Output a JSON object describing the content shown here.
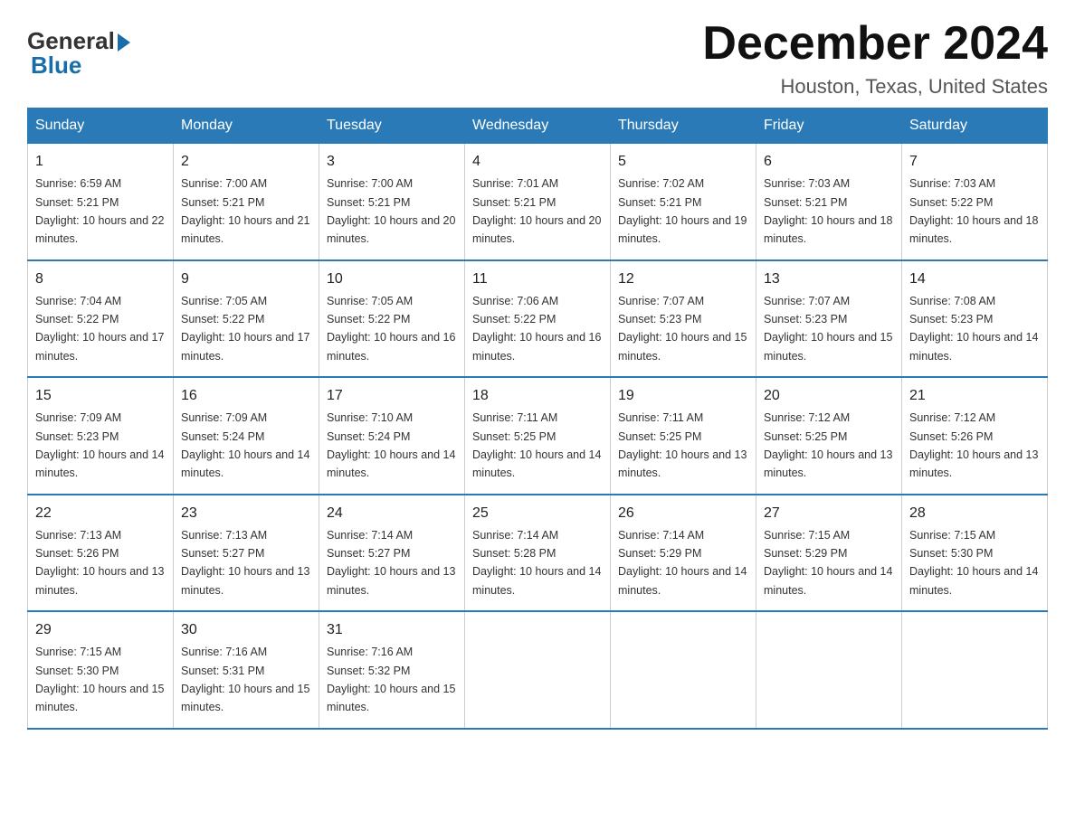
{
  "logo": {
    "general": "General",
    "blue": "Blue"
  },
  "title": "December 2024",
  "location": "Houston, Texas, United States",
  "weekdays": [
    "Sunday",
    "Monday",
    "Tuesday",
    "Wednesday",
    "Thursday",
    "Friday",
    "Saturday"
  ],
  "weeks": [
    [
      {
        "day": "1",
        "sunrise": "Sunrise: 6:59 AM",
        "sunset": "Sunset: 5:21 PM",
        "daylight": "Daylight: 10 hours and 22 minutes."
      },
      {
        "day": "2",
        "sunrise": "Sunrise: 7:00 AM",
        "sunset": "Sunset: 5:21 PM",
        "daylight": "Daylight: 10 hours and 21 minutes."
      },
      {
        "day": "3",
        "sunrise": "Sunrise: 7:00 AM",
        "sunset": "Sunset: 5:21 PM",
        "daylight": "Daylight: 10 hours and 20 minutes."
      },
      {
        "day": "4",
        "sunrise": "Sunrise: 7:01 AM",
        "sunset": "Sunset: 5:21 PM",
        "daylight": "Daylight: 10 hours and 20 minutes."
      },
      {
        "day": "5",
        "sunrise": "Sunrise: 7:02 AM",
        "sunset": "Sunset: 5:21 PM",
        "daylight": "Daylight: 10 hours and 19 minutes."
      },
      {
        "day": "6",
        "sunrise": "Sunrise: 7:03 AM",
        "sunset": "Sunset: 5:21 PM",
        "daylight": "Daylight: 10 hours and 18 minutes."
      },
      {
        "day": "7",
        "sunrise": "Sunrise: 7:03 AM",
        "sunset": "Sunset: 5:22 PM",
        "daylight": "Daylight: 10 hours and 18 minutes."
      }
    ],
    [
      {
        "day": "8",
        "sunrise": "Sunrise: 7:04 AM",
        "sunset": "Sunset: 5:22 PM",
        "daylight": "Daylight: 10 hours and 17 minutes."
      },
      {
        "day": "9",
        "sunrise": "Sunrise: 7:05 AM",
        "sunset": "Sunset: 5:22 PM",
        "daylight": "Daylight: 10 hours and 17 minutes."
      },
      {
        "day": "10",
        "sunrise": "Sunrise: 7:05 AM",
        "sunset": "Sunset: 5:22 PM",
        "daylight": "Daylight: 10 hours and 16 minutes."
      },
      {
        "day": "11",
        "sunrise": "Sunrise: 7:06 AM",
        "sunset": "Sunset: 5:22 PM",
        "daylight": "Daylight: 10 hours and 16 minutes."
      },
      {
        "day": "12",
        "sunrise": "Sunrise: 7:07 AM",
        "sunset": "Sunset: 5:23 PM",
        "daylight": "Daylight: 10 hours and 15 minutes."
      },
      {
        "day": "13",
        "sunrise": "Sunrise: 7:07 AM",
        "sunset": "Sunset: 5:23 PM",
        "daylight": "Daylight: 10 hours and 15 minutes."
      },
      {
        "day": "14",
        "sunrise": "Sunrise: 7:08 AM",
        "sunset": "Sunset: 5:23 PM",
        "daylight": "Daylight: 10 hours and 14 minutes."
      }
    ],
    [
      {
        "day": "15",
        "sunrise": "Sunrise: 7:09 AM",
        "sunset": "Sunset: 5:23 PM",
        "daylight": "Daylight: 10 hours and 14 minutes."
      },
      {
        "day": "16",
        "sunrise": "Sunrise: 7:09 AM",
        "sunset": "Sunset: 5:24 PM",
        "daylight": "Daylight: 10 hours and 14 minutes."
      },
      {
        "day": "17",
        "sunrise": "Sunrise: 7:10 AM",
        "sunset": "Sunset: 5:24 PM",
        "daylight": "Daylight: 10 hours and 14 minutes."
      },
      {
        "day": "18",
        "sunrise": "Sunrise: 7:11 AM",
        "sunset": "Sunset: 5:25 PM",
        "daylight": "Daylight: 10 hours and 14 minutes."
      },
      {
        "day": "19",
        "sunrise": "Sunrise: 7:11 AM",
        "sunset": "Sunset: 5:25 PM",
        "daylight": "Daylight: 10 hours and 13 minutes."
      },
      {
        "day": "20",
        "sunrise": "Sunrise: 7:12 AM",
        "sunset": "Sunset: 5:25 PM",
        "daylight": "Daylight: 10 hours and 13 minutes."
      },
      {
        "day": "21",
        "sunrise": "Sunrise: 7:12 AM",
        "sunset": "Sunset: 5:26 PM",
        "daylight": "Daylight: 10 hours and 13 minutes."
      }
    ],
    [
      {
        "day": "22",
        "sunrise": "Sunrise: 7:13 AM",
        "sunset": "Sunset: 5:26 PM",
        "daylight": "Daylight: 10 hours and 13 minutes."
      },
      {
        "day": "23",
        "sunrise": "Sunrise: 7:13 AM",
        "sunset": "Sunset: 5:27 PM",
        "daylight": "Daylight: 10 hours and 13 minutes."
      },
      {
        "day": "24",
        "sunrise": "Sunrise: 7:14 AM",
        "sunset": "Sunset: 5:27 PM",
        "daylight": "Daylight: 10 hours and 13 minutes."
      },
      {
        "day": "25",
        "sunrise": "Sunrise: 7:14 AM",
        "sunset": "Sunset: 5:28 PM",
        "daylight": "Daylight: 10 hours and 14 minutes."
      },
      {
        "day": "26",
        "sunrise": "Sunrise: 7:14 AM",
        "sunset": "Sunset: 5:29 PM",
        "daylight": "Daylight: 10 hours and 14 minutes."
      },
      {
        "day": "27",
        "sunrise": "Sunrise: 7:15 AM",
        "sunset": "Sunset: 5:29 PM",
        "daylight": "Daylight: 10 hours and 14 minutes."
      },
      {
        "day": "28",
        "sunrise": "Sunrise: 7:15 AM",
        "sunset": "Sunset: 5:30 PM",
        "daylight": "Daylight: 10 hours and 14 minutes."
      }
    ],
    [
      {
        "day": "29",
        "sunrise": "Sunrise: 7:15 AM",
        "sunset": "Sunset: 5:30 PM",
        "daylight": "Daylight: 10 hours and 15 minutes."
      },
      {
        "day": "30",
        "sunrise": "Sunrise: 7:16 AM",
        "sunset": "Sunset: 5:31 PM",
        "daylight": "Daylight: 10 hours and 15 minutes."
      },
      {
        "day": "31",
        "sunrise": "Sunrise: 7:16 AM",
        "sunset": "Sunset: 5:32 PM",
        "daylight": "Daylight: 10 hours and 15 minutes."
      },
      null,
      null,
      null,
      null
    ]
  ]
}
